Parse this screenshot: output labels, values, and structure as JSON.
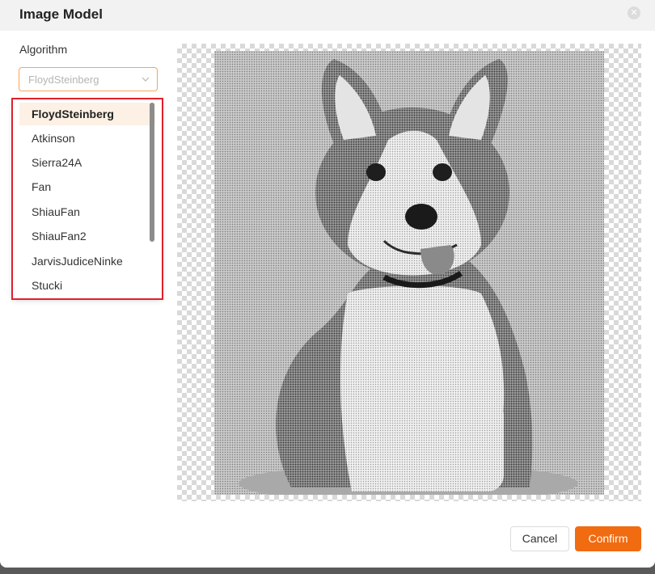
{
  "dialog": {
    "title": "Image Model",
    "close_icon": "close-icon"
  },
  "algorithm": {
    "label": "Algorithm",
    "selected": "FloydSteinberg",
    "options": [
      "FloydSteinberg",
      "Atkinson",
      "Sierra24A",
      "Fan",
      "ShiauFan",
      "ShiauFan2",
      "JarvisJudiceNinke",
      "Stucki"
    ]
  },
  "preview": {
    "image_subject": "dithered-corgi-photo"
  },
  "footer": {
    "cancel_label": "Cancel",
    "confirm_label": "Confirm"
  },
  "colors": {
    "accent": "#f16b10",
    "highlight_border": "#e0212b",
    "selected_option_bg": "#fdf0e4"
  }
}
